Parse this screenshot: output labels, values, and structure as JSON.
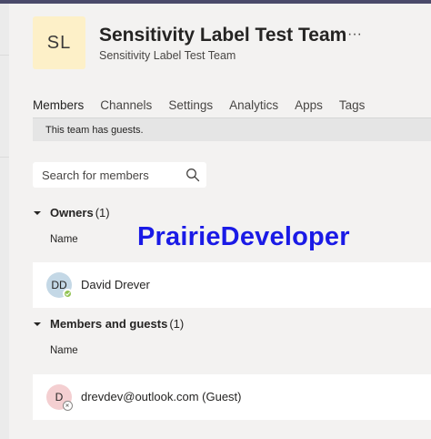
{
  "team": {
    "initials": "SL",
    "title": "Sensitivity Label Test Team",
    "subtitle": "Sensitivity Label Test Team",
    "more_glyph": "···"
  },
  "tabs": [
    {
      "label": "Members",
      "active": true
    },
    {
      "label": "Channels",
      "active": false
    },
    {
      "label": "Settings",
      "active": false
    },
    {
      "label": "Analytics",
      "active": false
    },
    {
      "label": "Apps",
      "active": false
    },
    {
      "label": "Tags",
      "active": false
    }
  ],
  "banner": {
    "text": "This team has guests."
  },
  "search": {
    "placeholder": "Search for members",
    "value": ""
  },
  "owners": {
    "title": "Owners",
    "count": "(1)",
    "column_name": "Name",
    "members": [
      {
        "initials": "DD",
        "name": "David Drever",
        "status": "available",
        "avatar_color": "#c4d8e6",
        "status_color": "#92c353"
      }
    ]
  },
  "guests": {
    "title": "Members and guests",
    "count": "(1)",
    "column_name": "Name",
    "members": [
      {
        "initials": "D",
        "name": "drevdev@outlook.com (Guest)",
        "status": "offline",
        "avatar_color": "#f4cfd1",
        "status_color": "#ffffff"
      }
    ]
  },
  "watermark": {
    "text": "PrairieDeveloper",
    "color": "#1a1ae6"
  },
  "colors": {
    "accent": "#6264a7",
    "background": "#f3f2f1"
  }
}
